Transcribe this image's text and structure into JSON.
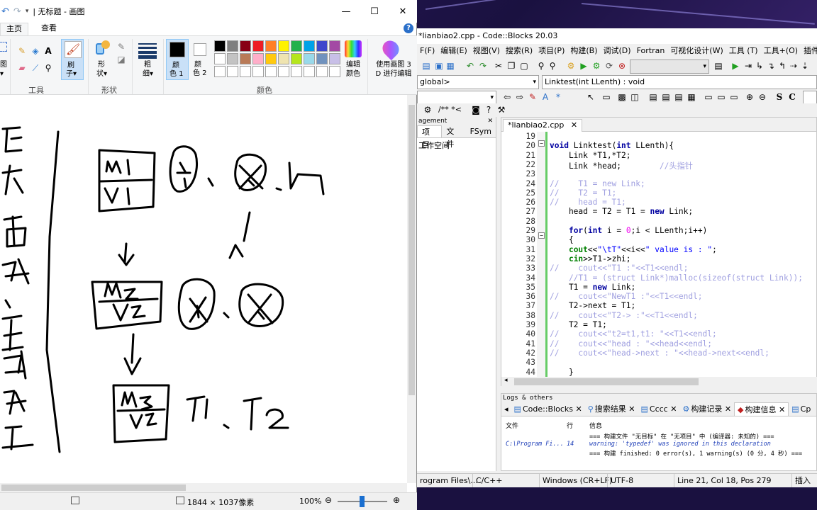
{
  "paint": {
    "qa_glyphs": [
      "↶",
      "↷",
      "▾"
    ],
    "title": "| 无标题 - 画图",
    "win_buttons": [
      "—",
      "☐",
      "✕"
    ],
    "tabs": [
      "主页",
      "查看"
    ],
    "ribbon": {
      "image_group_fragment": "图",
      "tools_label": "工具",
      "brush_label_1": "刷",
      "brush_label_2": "子▾",
      "shapes_label_1": "形",
      "shapes_label_2": "状▾",
      "shapes_group": "形状",
      "size_label_1": "粗",
      "size_label_2": "细▾",
      "color1_label_1": "颜",
      "color1_label_2": "色 1",
      "color2_label_1": "颜",
      "color2_label_2": "色 2",
      "colors_group": "颜色",
      "edit_colors_1": "编辑",
      "edit_colors_2": "颜色",
      "paint3d_1": "使用画图 3",
      "paint3d_2": "D 进行编辑"
    },
    "palette_row1": [
      "#000000",
      "#7f7f7f",
      "#880015",
      "#ed1c24",
      "#ff7f27",
      "#fff200",
      "#22b14c",
      "#00a2e8",
      "#3f48cc",
      "#a349a4"
    ],
    "palette_row2": [
      "#ffffff",
      "#c3c3c3",
      "#b97a57",
      "#ffaec9",
      "#ffc90e",
      "#efe4b0",
      "#b5e61d",
      "#99d9ea",
      "#7092be",
      "#c8bfe7"
    ],
    "status": {
      "dimensions": "1844 × 1037像素",
      "zoom": "100%"
    }
  },
  "codeblocks": {
    "title": "*lianbiao2.cpp - Code::Blocks 20.03",
    "menu": [
      "F(F)",
      "编辑(E)",
      "视图(V)",
      "搜索(R)",
      "项目(P)",
      "构建(B)",
      "调试(D)",
      "Fortran",
      "可视化设计(W)",
      "工具 (T)",
      "工具+(O)",
      "插件(E)",
      "Doxyb"
    ],
    "scope_combo": "global>",
    "function_combo": "Linktest(int LLenth) : void",
    "toolbar3_text": "/** *<",
    "management": {
      "header": "agement",
      "tabs": [
        "项目",
        "文件",
        "FSym"
      ],
      "tree_item": "工作空间"
    },
    "editor_tab": "*lianbiao2.cpp",
    "code_lines": [
      {
        "n": "19",
        "t": ""
      },
      {
        "n": "20",
        "t": "void Linktest(int LLenth){"
      },
      {
        "n": "21",
        "t": "    Link *T1,*T2;"
      },
      {
        "n": "22",
        "t": "    Link *head;        //头指针"
      },
      {
        "n": "23",
        "t": ""
      },
      {
        "n": "24",
        "t": "//    T1 = new Link;"
      },
      {
        "n": "25",
        "t": "//    T2 = T1;"
      },
      {
        "n": "26",
        "t": "//    head = T1;"
      },
      {
        "n": "27",
        "t": "    head = T2 = T1 = new Link;"
      },
      {
        "n": "28",
        "t": ""
      },
      {
        "n": "29",
        "t": "    for(int i = 0;i < LLenth;i++)"
      },
      {
        "n": "30",
        "t": "    {"
      },
      {
        "n": "31",
        "t": "    cout<<\"\\tT\"<<i<<\" value is : \";"
      },
      {
        "n": "32",
        "t": "    cin>>T1->zhi;"
      },
      {
        "n": "33",
        "t": "//    cout<<\"T1 :\"<<T1<<endl;"
      },
      {
        "n": "34",
        "t": "    //T1 = (struct Link*)malloc(sizeof(struct Link));"
      },
      {
        "n": "35",
        "t": "    T1 = new Link;"
      },
      {
        "n": "36",
        "t": "//    cout<<\"NewT1 :\"<<T1<<endl;"
      },
      {
        "n": "37",
        "t": "    T2->next = T1;"
      },
      {
        "n": "38",
        "t": "//    cout<<\"T2-> :\"<<T1<<endl;"
      },
      {
        "n": "39",
        "t": "    T2 = T1;"
      },
      {
        "n": "40",
        "t": "//    cout<<\"t2=t1,t1: \"<<T1<<endl;"
      },
      {
        "n": "41",
        "t": "//    cout<<\"head : \"<<head<<endl;"
      },
      {
        "n": "42",
        "t": "//    cout<<\"head->next : \"<<head->next<<endl;"
      },
      {
        "n": "43",
        "t": ""
      },
      {
        "n": "44",
        "t": "    }"
      }
    ],
    "logs": {
      "header": "Logs & others",
      "tabs": [
        "Code::Blocks",
        "搜索结果",
        "Cccc",
        "构建记录",
        "构建信息",
        "Cp"
      ],
      "columns": [
        "文件",
        "行",
        "信息"
      ],
      "rows": [
        {
          "file": "",
          "line": "",
          "msg": "=== 构建文件 \"无目标\" 在 \"无项目\" 中 (编译器: 未知的) ==="
        },
        {
          "file": "C:\\Program Fi...",
          "line": "14",
          "msg": "warning: 'typedef' was ignored in this declaration"
        },
        {
          "file": "",
          "line": "",
          "msg": "=== 构建 finished: 0 error(s), 1 warning(s) (0 分, 4 秒) ==="
        }
      ]
    },
    "status": {
      "path": "rogram Files\\...",
      "lang": "C/C++",
      "eol": "Windows (CR+LF)",
      "encoding": "UTF-8",
      "position": "Line 21, Col 18, Pos 279",
      "mode": "插入"
    }
  }
}
